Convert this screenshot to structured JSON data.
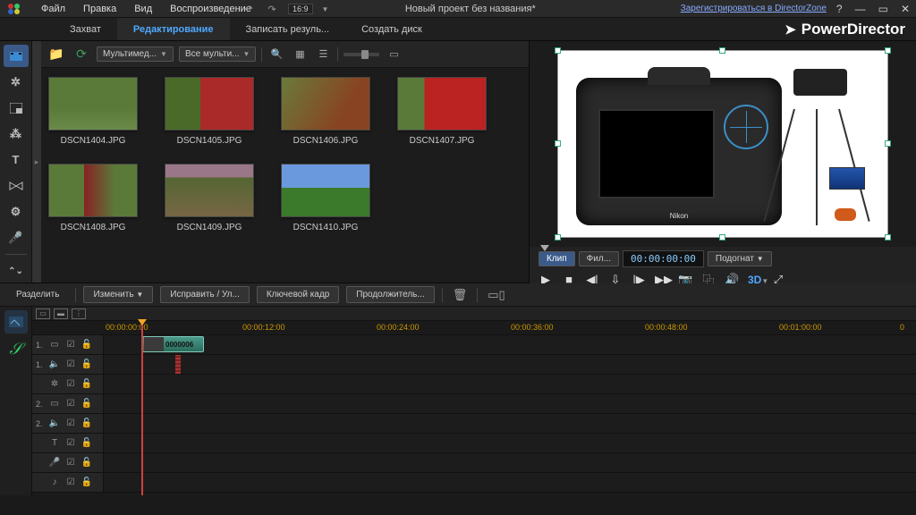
{
  "menubar": {
    "items": [
      "Файл",
      "Правка",
      "Вид",
      "Воспроизведение"
    ],
    "title": "Новый проект без названия*",
    "dz_link": "Зарегистрироваться в DirectorZone",
    "ratio_box": "16:9"
  },
  "brand": "PowerDirector",
  "modetabs": {
    "capture": "Захват",
    "edit": "Редактирование",
    "produce": "Записать резуль...",
    "disc": "Создать диск"
  },
  "library": {
    "dropdown1": "Мультимед...",
    "dropdown2": "Все мульти...",
    "thumbs": [
      {
        "name": "DSCN1404.JPG"
      },
      {
        "name": "DSCN1405.JPG"
      },
      {
        "name": "DSCN1406.JPG"
      },
      {
        "name": "DSCN1407.JPG"
      },
      {
        "name": "DSCN1408.JPG"
      },
      {
        "name": "DSCN1409.JPG"
      },
      {
        "name": "DSCN1410.JPG"
      }
    ]
  },
  "preview": {
    "subject_brand": "Nikon",
    "tab_clip": "Клип",
    "tab_film": "Фил...",
    "timecode": "00:00:00:00",
    "fit": "Подогнат",
    "threeD": "3D"
  },
  "timeline_toolbar": {
    "split": "Разделить",
    "modify": "Изменить",
    "fix": "Исправить / Ул...",
    "keyframe": "Ключевой кадр",
    "duration": "Продолжитель..."
  },
  "ruler": {
    "marks": [
      "00:00:00:00",
      "00:00:12:00",
      "00:00:24:00",
      "00:00:36:00",
      "00:00:48:00",
      "00:01:00:00"
    ]
  },
  "clip": {
    "tc": "0000006"
  },
  "track_labels": {
    "v1": "1.",
    "v2": "1.",
    "v3": "2.",
    "v4": "2."
  }
}
